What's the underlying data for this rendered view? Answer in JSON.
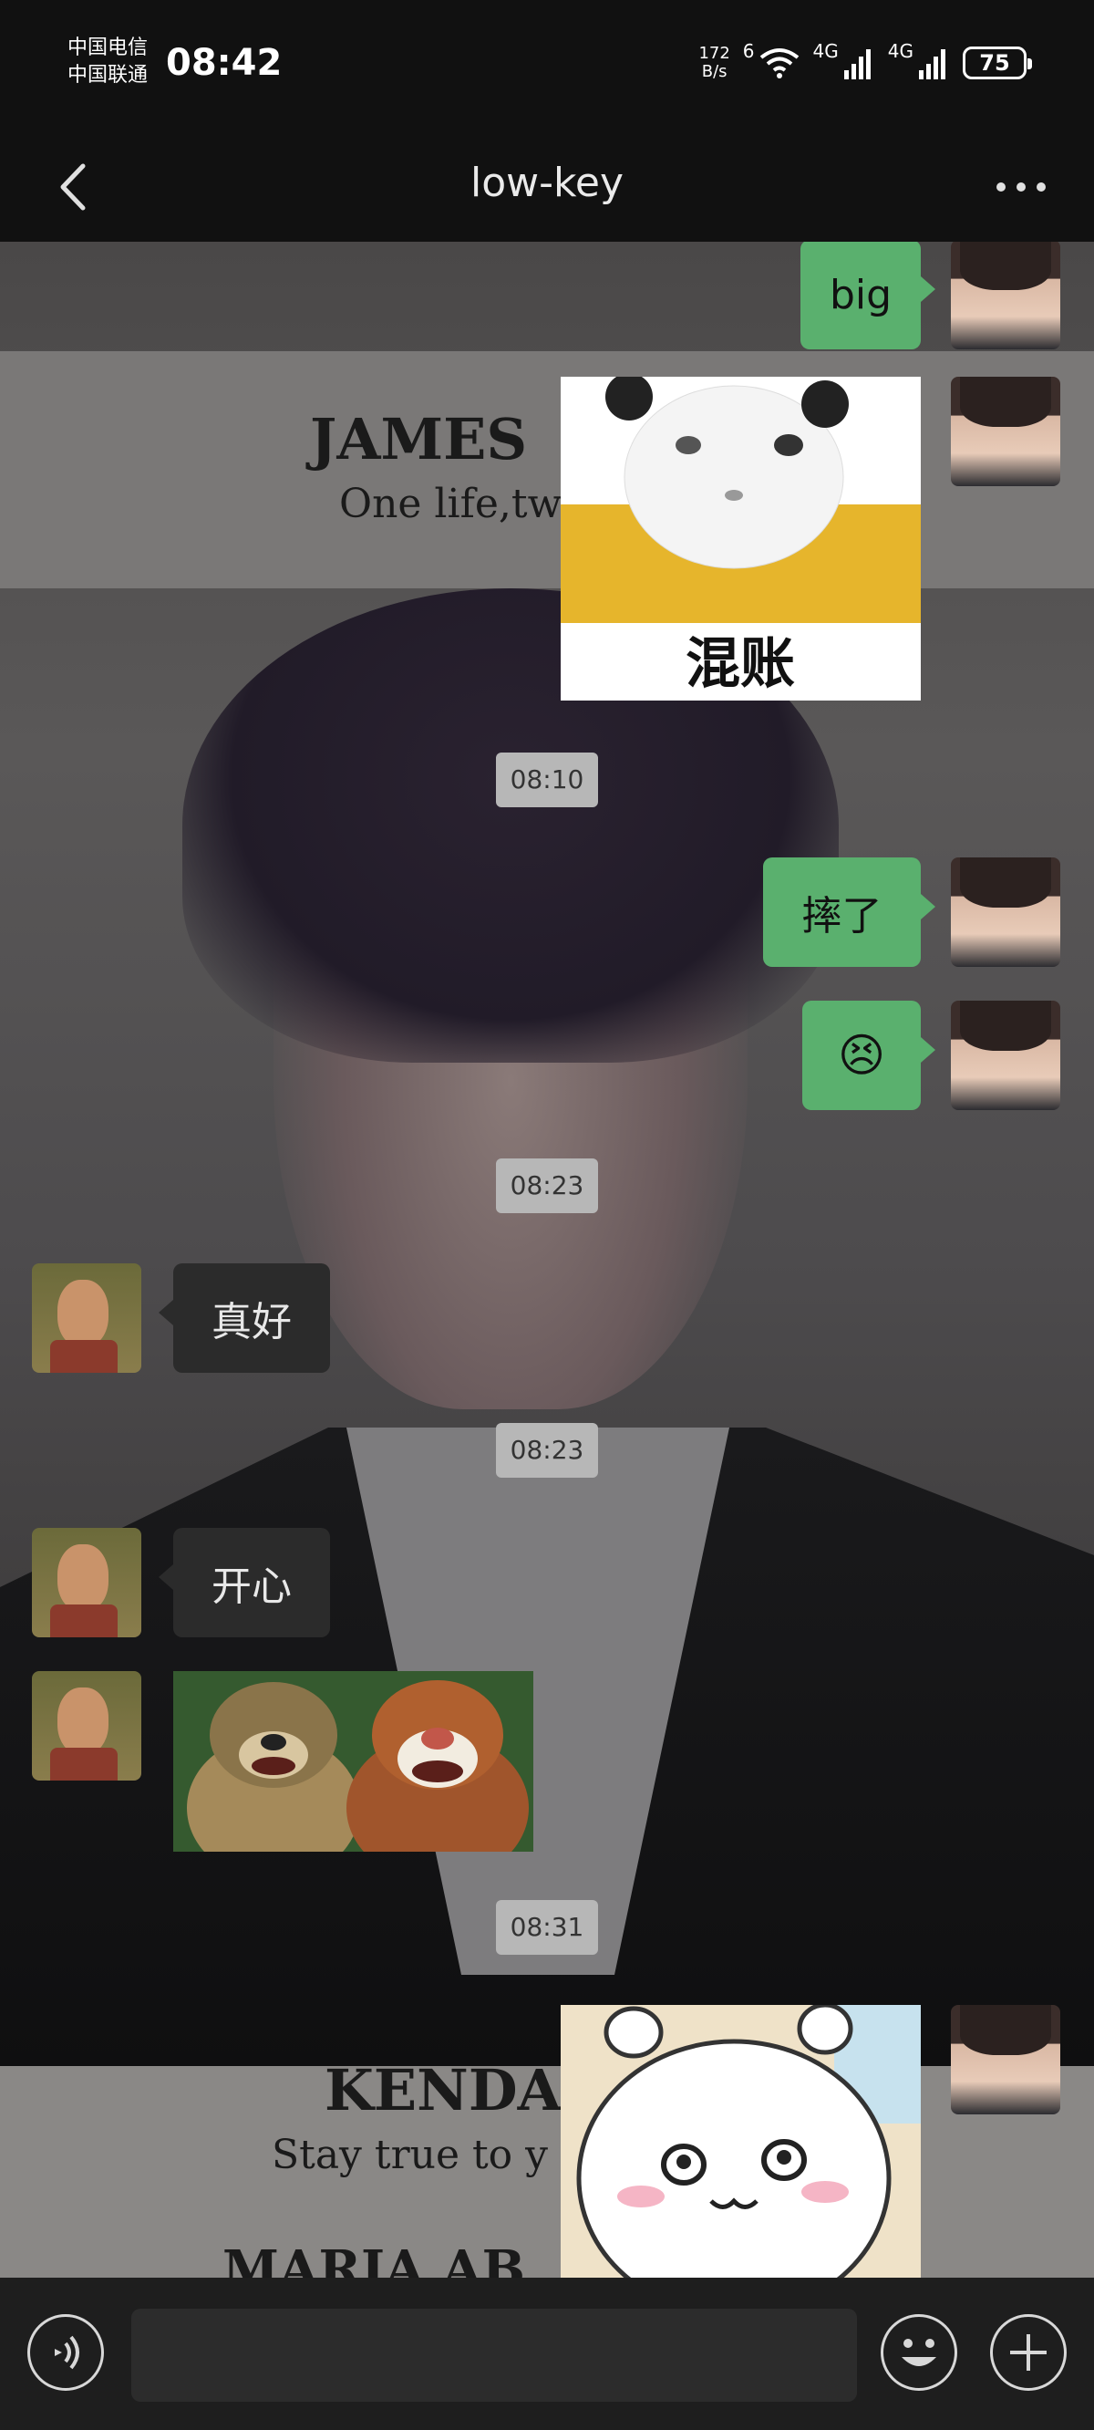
{
  "status_bar": {
    "carrier_1": "中国电信",
    "carrier_2": "中国联通",
    "time": "08:42",
    "net_speed_value": "172",
    "net_speed_unit": "B/s",
    "wifi_label": "6",
    "signal_1_label": "4G",
    "signal_2_label": "4G",
    "battery": "75"
  },
  "nav": {
    "title": "low-key",
    "back_icon": "chevron-left-icon",
    "more_icon": "more-dots-icon"
  },
  "background_text": {
    "line1": "JAMES",
    "line2": "One life,tw",
    "line3": "KENDA",
    "line4": "Stay true to y",
    "line5": "MARIA AB"
  },
  "messages": [
    {
      "side": "me",
      "type": "text",
      "text": "big"
    },
    {
      "side": "me",
      "type": "sticker",
      "caption": "混账",
      "icon": "panda-meme-sticker"
    },
    {
      "type": "time",
      "text": "08:10"
    },
    {
      "side": "me",
      "type": "text",
      "text": "摔了"
    },
    {
      "side": "me",
      "type": "emoji",
      "text": "😣",
      "icon": "persevering-face-emoji"
    },
    {
      "type": "time",
      "text": "08:23"
    },
    {
      "side": "them",
      "type": "text",
      "text": "真好"
    },
    {
      "type": "time",
      "text": "08:23"
    },
    {
      "side": "them",
      "type": "text",
      "text": "开心"
    },
    {
      "side": "them",
      "type": "sticker",
      "icon": "cartoon-bears-sticker"
    },
    {
      "type": "time",
      "text": "08:31"
    },
    {
      "side": "me",
      "type": "sticker",
      "icon": "white-bunny-sticker"
    }
  ],
  "input_bar": {
    "voice_icon": "voice-icon",
    "emoji_icon": "emoji-icon",
    "plus_icon": "plus-icon",
    "placeholder": ""
  },
  "colors": {
    "my_bubble": "#5ab06e",
    "their_bubble": "#2b2b2b",
    "timestamp_bg": "#b7b7b7",
    "bar_bg": "#111111"
  }
}
